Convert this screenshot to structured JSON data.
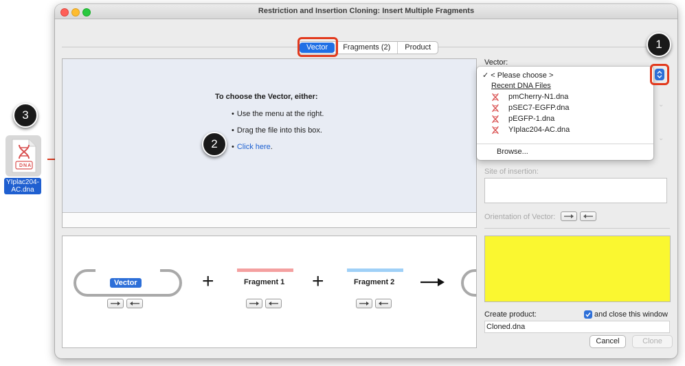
{
  "window": {
    "title": "Restriction and Insertion Cloning: Insert Multiple Fragments"
  },
  "tabs": [
    {
      "label": "Vector",
      "active": true
    },
    {
      "label": "Fragments (2)",
      "active": false
    },
    {
      "label": "Product",
      "active": false
    }
  ],
  "dropbox": {
    "heading": "To choose the Vector, either:",
    "bullets": [
      "Use the menu at the right.",
      "Drag the file into this box."
    ],
    "link_text": "Click here",
    "link_suffix": "."
  },
  "diagram": {
    "vector_label": "Vector",
    "fragment1_label": "Fragment 1",
    "fragment2_label": "Fragment 2",
    "plus": "+",
    "arrow": "→",
    "fragment1_color": "#f4a0a0",
    "fragment2_color": "#9fd0f7",
    "vector_color": "#2d6fd8"
  },
  "right_panel": {
    "vector_label": "Vector:",
    "site_of_insertion_label": "Site of insertion:",
    "orientation_label": "Orientation of Vector:",
    "create_product_label": "Create product:",
    "close_window_label": "and close this window",
    "close_window_checked": true,
    "product_name": "Cloned.dna",
    "cancel_button": "Cancel",
    "clone_button": "Clone",
    "preview_color": "#faf730"
  },
  "vector_menu": {
    "selected": "< Please choose >",
    "recent_header": "Recent DNA Files",
    "recent_files": [
      "pmCherry-N1.dna",
      "pSEC7-EGFP.dna",
      "pEGFP-1.dna",
      "YIplac204-AC.dna"
    ],
    "browse": "Browse..."
  },
  "callouts": [
    "1",
    "2",
    "3"
  ],
  "desktop_file": {
    "name_line1": "YIplac204-",
    "name_line2": "AC.dna",
    "icon_text": "DNA",
    "icon": "dna-file-icon"
  },
  "colors": {
    "accent": "#2d6fd8",
    "highlight": "#e2391c",
    "dna_red": "#d94f4f"
  }
}
